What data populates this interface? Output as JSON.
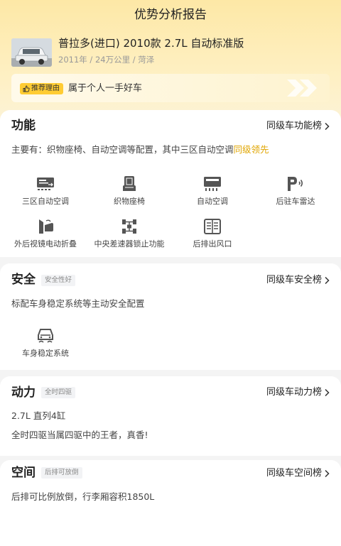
{
  "header": {
    "title": "优势分析报告"
  },
  "car": {
    "thumbnail_icon": "car-photo",
    "name": "普拉多(进口) 2010款 2.7L 自动标准版",
    "meta": "2011年 / 24万公里 / 菏泽"
  },
  "reason": {
    "badge_label": "推荐理由",
    "badge_icon": "thumbs-up-icon",
    "text": "属于个人一手好车"
  },
  "sections": {
    "function": {
      "title": "功能",
      "rank_label": "同级车功能榜",
      "summary_prefix": "主要有：织物座椅、自动空调等配置，其中三区自动空调",
      "summary_highlight": "同级领先",
      "highlight_color": "#e0a500",
      "features": [
        {
          "label": "三区自动空调",
          "icon": "tri-zone-ac-icon"
        },
        {
          "label": "织物座椅",
          "icon": "fabric-seat-icon"
        },
        {
          "label": "自动空调",
          "icon": "auto-ac-icon"
        },
        {
          "label": "后驻车雷达",
          "icon": "parking-radar-icon"
        },
        {
          "label": "外后视镜电动折叠",
          "icon": "mirror-fold-icon"
        },
        {
          "label": "中央差速器锁止功能",
          "icon": "diff-lock-icon"
        },
        {
          "label": "后排出风口",
          "icon": "rear-vent-icon"
        }
      ]
    },
    "safety": {
      "title": "安全",
      "tag": "安全性好",
      "rank_label": "同级车安全榜",
      "summary": "标配车身稳定系统等主动安全配置",
      "features": [
        {
          "label": "车身稳定系统",
          "icon": "stability-control-icon"
        }
      ]
    },
    "power": {
      "title": "动力",
      "tag": "全时四驱",
      "rank_label": "同级车动力榜",
      "line1": "2.7L 直列4缸",
      "line2": "全时四驱当属四驱中的王者，真香!"
    },
    "space": {
      "title": "空间",
      "tag": "后排可放倒",
      "rank_label": "同级车空间榜",
      "summary": "后排可比例放倒，行李厢容积1850L"
    }
  }
}
